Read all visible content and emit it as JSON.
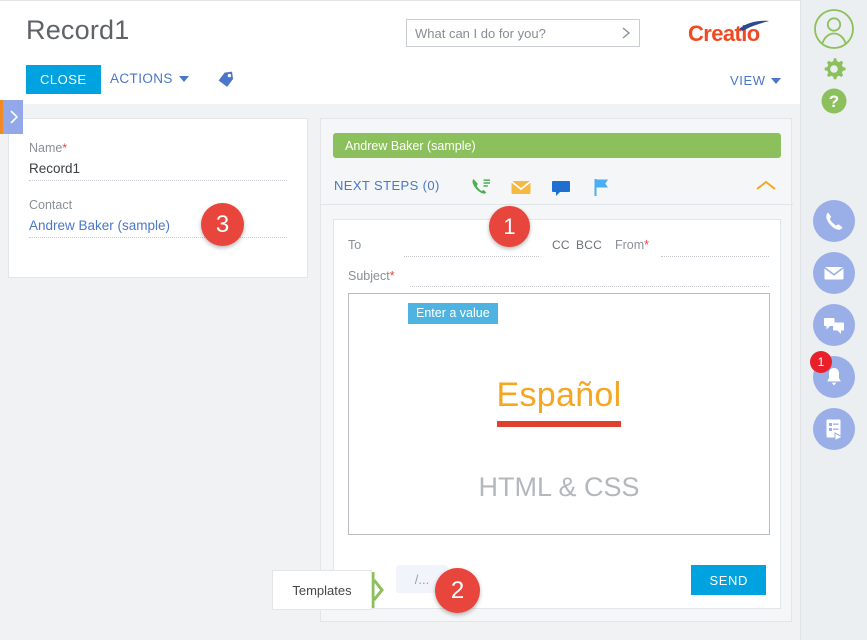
{
  "header": {
    "record_title": "Record1",
    "close_label": "CLOSE",
    "actions_label": "ACTIONS",
    "view_label": "VIEW",
    "tag_icon": "tag-icon",
    "logo_text": "Creatio",
    "search": {
      "placeholder": "What can I do for you?",
      "value": "",
      "go_icon": "chevron-right-icon"
    }
  },
  "left_tab": {
    "icon": "chevron-right-icon"
  },
  "left_panel": {
    "fields": [
      {
        "label": "Name",
        "required": "*",
        "value": "Record1",
        "is_link": false
      },
      {
        "label": "Contact",
        "required": "",
        "value": "Andrew Baker (sample)",
        "is_link": true
      }
    ]
  },
  "right_panel": {
    "banner_text": "Andrew Baker (sample)",
    "next_steps_label": "NEXT STEPS (0)",
    "action_icons": [
      {
        "name": "phone-call-icon",
        "color": "#4caf50"
      },
      {
        "name": "email-icon",
        "color": "#f5b942"
      },
      {
        "name": "comment-icon",
        "color": "#1f6fd0"
      },
      {
        "name": "flag-icon",
        "color": "#49aef5"
      }
    ],
    "collapse_icon": "chevron-up-icon"
  },
  "email_form": {
    "to_label": "To",
    "cc_label": "CC",
    "bcc_label": "BCC",
    "from_label": "From",
    "from_required": "*",
    "subject_label": "Subject",
    "subject_required": "*",
    "to_value": "",
    "from_value": "",
    "subject_value": "",
    "template_preview": {
      "title": "Español",
      "subtitle": "HTML & CSS"
    },
    "slash_button_label": "/...",
    "send_label": "SEND"
  },
  "tooltips": {
    "enter_a_value": "Enter a value",
    "templates": "Templates"
  },
  "step_badges": [
    {
      "number": "1"
    },
    {
      "number": "2"
    },
    {
      "number": "3"
    }
  ],
  "rail": {
    "top_icons": [
      {
        "name": "user-avatar-icon"
      },
      {
        "name": "gear-icon"
      },
      {
        "name": "help-question-icon"
      }
    ],
    "circles": [
      {
        "name": "phone-icon",
        "badge": ""
      },
      {
        "name": "envelope-icon",
        "badge": ""
      },
      {
        "name": "chat-icon",
        "badge": ""
      },
      {
        "name": "bell-icon",
        "badge": "1"
      },
      {
        "name": "feed-icon",
        "badge": ""
      }
    ]
  },
  "colors": {
    "accent_blue": "#00a3e0",
    "link_blue": "#4a77c9",
    "brand_orange": "#ef4a23",
    "banner_green": "#8cc05c",
    "badge_red": "#e8453c",
    "rail_blue": "#9aafe8",
    "rail_green": "#8cc05c"
  }
}
